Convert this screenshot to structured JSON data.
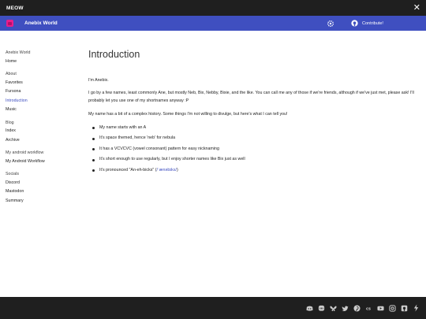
{
  "window": {
    "title": "MEOW"
  },
  "header": {
    "site_title": "Anebix World",
    "contribute_label": "Contribute!"
  },
  "sidebar": {
    "sections": [
      {
        "heading": "Anebix World",
        "items": [
          "Home"
        ]
      },
      {
        "heading": "About",
        "items": [
          "Favorites",
          "Fursona",
          "Introduction",
          "Music"
        ]
      },
      {
        "heading": "Blog",
        "items": [
          "Index",
          "Archive"
        ]
      },
      {
        "heading": "My android workflow",
        "items": [
          "My Android Workflow"
        ]
      },
      {
        "heading": "Socials",
        "items": [
          "Discord",
          "Mastodon",
          "Summary"
        ]
      }
    ],
    "active_item": "Introduction"
  },
  "content": {
    "title": "Introduction",
    "para1": "I'm Anebix.",
    "para2": "I go by a few names, least commonly Ane, but mostly Neb, Bix, Nebby, Bixie, and the like. You can call me any of those if we're friends, although if we've just met, please ask! I'll probably let you use one of my shortnames anyway :P",
    "para3": "My name has a bit of a complex history. Some things I'm not willing to divulge, but here's what I can tell you!",
    "bullets": [
      "My name starts with an A",
      "It's space themed, hence 'neb' for nebula",
      "It has a VCVCVC (vowel consonant) pattern for easy nicknaming",
      "It's short enough to use regularly, but I enjoy shorter names like Bix just as well"
    ],
    "pronunciation_text": "It's pronounced \"An-eh-bicks\" (",
    "pronunciation_ipa": "/ˈænəbɪks/",
    "pronunciation_close": ")"
  },
  "footer": {
    "social_icons": [
      "discord-icon",
      "mastodon-icon",
      "bluesky-icon",
      "twitter-icon",
      "pinterest-icon",
      "lastfm-icon",
      "youtube-icon",
      "instagram-icon",
      "github-icon",
      "kofi-icon"
    ]
  },
  "colors": {
    "accent": "#3f4fc0",
    "logo": "#e91e8c",
    "titlebar": "#1f1f1f"
  }
}
